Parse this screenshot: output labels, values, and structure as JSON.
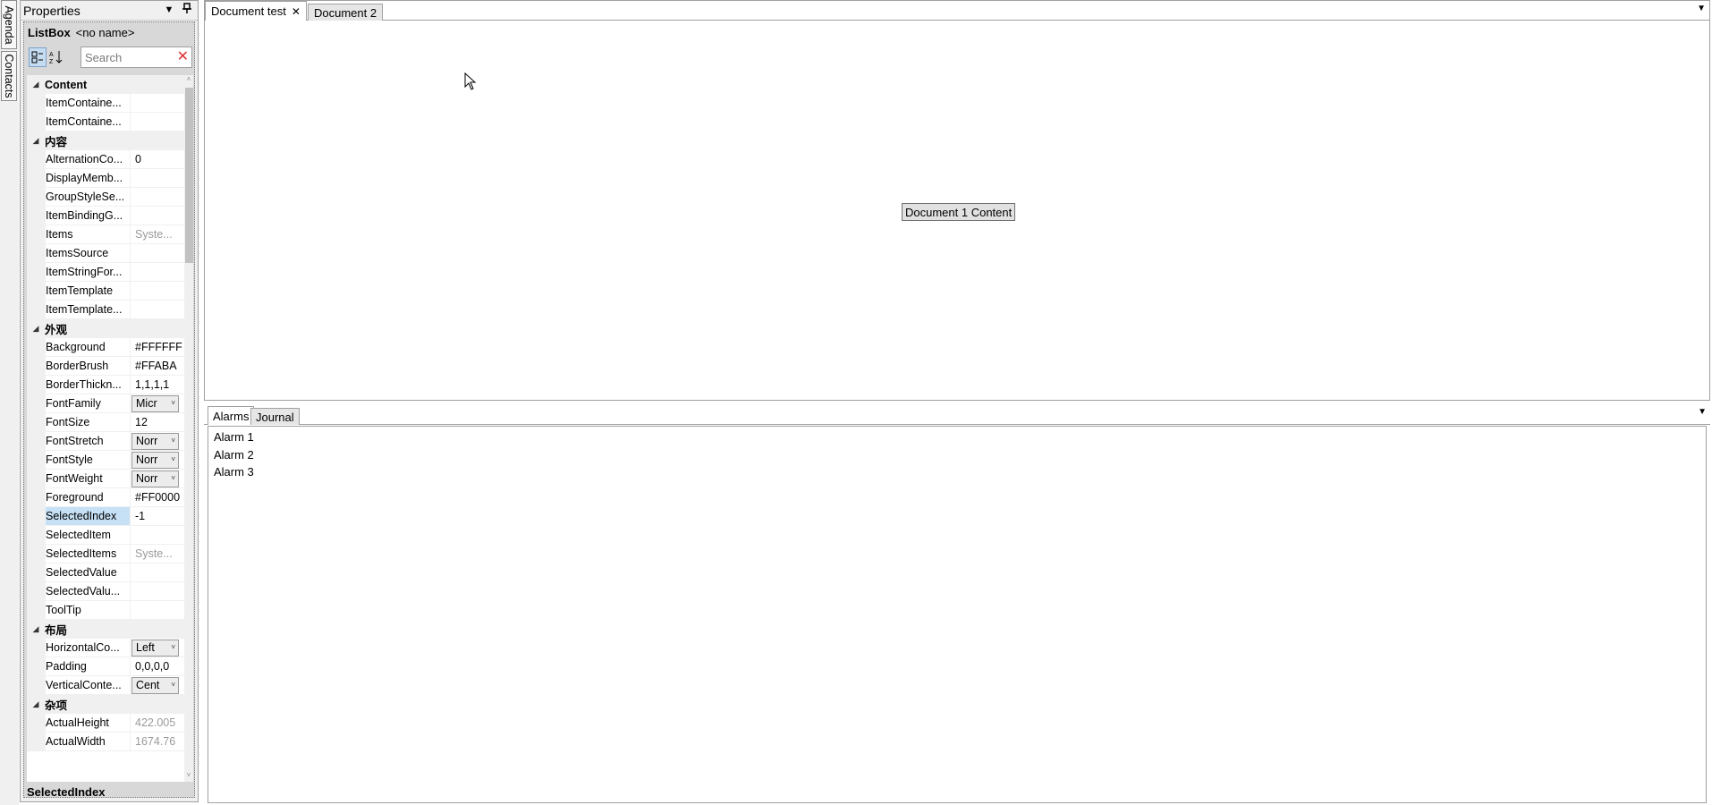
{
  "side_tabs": [
    "Agenda",
    "Contacts"
  ],
  "properties_panel": {
    "title": "Properties",
    "selected_type": "ListBox",
    "selected_name": "<no name>",
    "search_placeholder": "Search",
    "categories": [
      {
        "name": "Content",
        "rows": [
          {
            "name": "ItemContaine...",
            "value": ""
          },
          {
            "name": "ItemContaine...",
            "value": ""
          }
        ]
      },
      {
        "name": "内容",
        "rows": [
          {
            "name": "AlternationCo...",
            "value": "0"
          },
          {
            "name": "DisplayMemb...",
            "value": ""
          },
          {
            "name": "GroupStyleSe...",
            "value": ""
          },
          {
            "name": "ItemBindingG...",
            "value": ""
          },
          {
            "name": "Items",
            "value": "Syste...",
            "muted": true
          },
          {
            "name": "ItemsSource",
            "value": ""
          },
          {
            "name": "ItemStringFor...",
            "value": ""
          },
          {
            "name": "ItemTemplate",
            "value": ""
          },
          {
            "name": "ItemTemplate...",
            "value": ""
          }
        ]
      },
      {
        "name": "外观",
        "rows": [
          {
            "name": "Background",
            "value": "#FFFFFF"
          },
          {
            "name": "BorderBrush",
            "value": "#FFABA"
          },
          {
            "name": "BorderThickn...",
            "value": "1,1,1,1"
          },
          {
            "name": "FontFamily",
            "value": "Micr",
            "combo": true
          },
          {
            "name": "FontSize",
            "value": "12"
          },
          {
            "name": "FontStretch",
            "value": "Norr",
            "combo": true
          },
          {
            "name": "FontStyle",
            "value": "Norr",
            "combo": true
          },
          {
            "name": "FontWeight",
            "value": "Norr",
            "combo": true
          },
          {
            "name": "Foreground",
            "value": "#FF0000"
          },
          {
            "name": "SelectedIndex",
            "value": "-1",
            "selected": true
          },
          {
            "name": "SelectedItem",
            "value": ""
          },
          {
            "name": "SelectedItems",
            "value": "Syste...",
            "muted": true
          },
          {
            "name": "SelectedValue",
            "value": ""
          },
          {
            "name": "SelectedValu...",
            "value": ""
          },
          {
            "name": "ToolTip",
            "value": ""
          }
        ]
      },
      {
        "name": "布局",
        "rows": [
          {
            "name": "HorizontalCo...",
            "value": "Left",
            "combo": true
          },
          {
            "name": "Padding",
            "value": "0,0,0,0"
          },
          {
            "name": "VerticalConte...",
            "value": "Cent",
            "combo": true
          }
        ]
      },
      {
        "name": "杂项",
        "rows": [
          {
            "name": "ActualHeight",
            "value": "422.005",
            "muted": true
          },
          {
            "name": "ActualWidth",
            "value": "1674.76",
            "muted": true
          }
        ]
      }
    ],
    "description_title": "SelectedIndex"
  },
  "documents": {
    "tabs": [
      {
        "label": "Document test",
        "active": true,
        "closable": true
      },
      {
        "label": "Document 2",
        "active": false
      }
    ],
    "content_button": "Document 1 Content"
  },
  "bottom_panel": {
    "tabs": [
      {
        "label": "Alarms",
        "active": true
      },
      {
        "label": "Journal",
        "active": false
      }
    ],
    "items": [
      "Alarm 1",
      "Alarm 2",
      "Alarm 3"
    ]
  }
}
